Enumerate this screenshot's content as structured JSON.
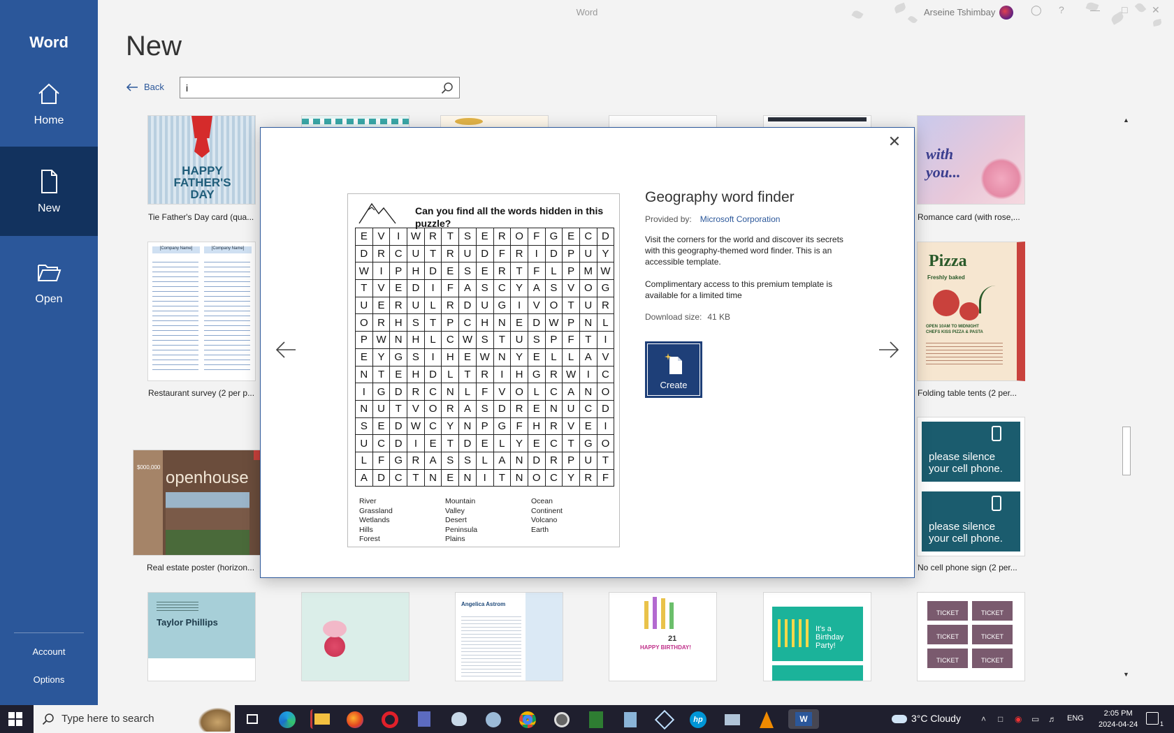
{
  "app": {
    "title": "Word",
    "user_name": "Arseine Tshimbay"
  },
  "nav": {
    "brand": "Word",
    "items": [
      {
        "id": "home",
        "label": "Home"
      },
      {
        "id": "new",
        "label": "New"
      },
      {
        "id": "open",
        "label": "Open"
      }
    ],
    "bottom": [
      "Account",
      "Options"
    ]
  },
  "header": {
    "title": "New",
    "back_label": "Back",
    "search_value": "i"
  },
  "gallery": {
    "labels": {
      "fathers_day": "Tie Father's Day card (qua...",
      "romance": "Romance card (with rose,...",
      "restaurant": "Restaurant survey (2 per p...",
      "table_tents": "Folding table tents (2 per...",
      "real_estate": "Real estate poster (horizon...",
      "cell_phone": "No cell phone sign (2 per..."
    },
    "thumb_text": {
      "fathers_day": "HAPPY FATHER'S DAY",
      "romance": "with you...",
      "pizza_title": "Pizza",
      "pizza_sub": "Freshly baked",
      "pizza_hours": "OPEN 10AM TO MIDNIGHT",
      "pizza_chef": "CHEFS KISS PIZZA & PASTA",
      "silence": "please silence your cell phone.",
      "openhouse": "openhouse",
      "price": "$000,000",
      "name_card": "Taylor Phillips",
      "resume_name": "Angelica Astrom",
      "birthday": "HAPPY BIRTHDAY!",
      "birthday_num": "21",
      "party": "It's a Birthday Party!",
      "ticket": "TICKET",
      "company": "[Company Name]"
    }
  },
  "modal": {
    "title": "Geography word finder",
    "provided_by_label": "Provided by:",
    "provider": "Microsoft Corporation",
    "description": "Visit the corners for the world and discover its secrets with this geography-themed word finder. This is an accessible template.",
    "premium_note": "Complimentary access to this premium template is available for a limited time",
    "download_label": "Download size:",
    "download_size": "41 KB",
    "create_label": "Create",
    "puzzle_question": "Can you find all the words hidden in this puzzle?",
    "grid_rows": [
      "EVIWRTSEROFGECD",
      "DRCUTRUDFRIDPUY",
      "WIPHDESERTFLPMW",
      "TVEDIFASCYASVOG",
      "UERULRDUGIVOTUR",
      "ORHSTPCHNEDWPNL",
      "PWNHLCWSTUSPFTI",
      "EYGSIHEWNYELLAV",
      "NTEHDLTRIHGRWIC",
      "IGDRCNLFVOLCANO",
      "NUTVORASDRENUCD",
      "SEDWCYNPGFHRVEI",
      "UCDIETDELYECTGO",
      "LFGRASSLANDRPUT",
      "ADCTNENITNOCYRF"
    ],
    "word_columns": [
      [
        "River",
        "Grassland",
        "Wetlands",
        "Hills",
        "Forest"
      ],
      [
        "Mountain",
        "Valley",
        "Desert",
        "Peninsula",
        "Plains"
      ],
      [
        "Ocean",
        "Continent",
        "Volcano",
        "Earth"
      ]
    ]
  },
  "taskbar": {
    "search_placeholder": "Type here to search",
    "weather": "3°C  Cloudy",
    "language": "ENG",
    "time": "2:05 PM",
    "date": "2024-04-24",
    "notifications": "1"
  },
  "colors": {
    "word_blue": "#2b579a",
    "nav_active": "#12325e",
    "create_bg": "#1e3f78"
  }
}
